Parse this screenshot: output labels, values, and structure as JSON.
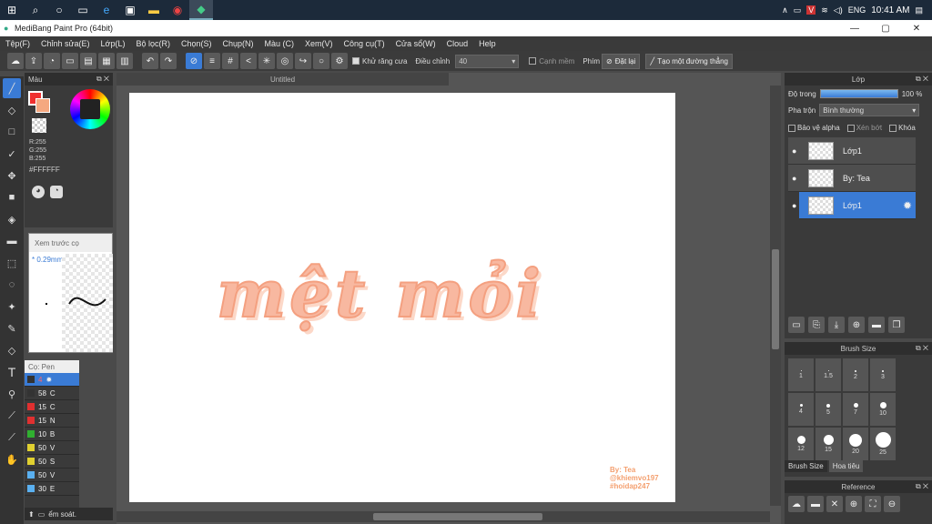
{
  "taskbar": {
    "tray": {
      "lang": "ENG",
      "time": "10:41 AM"
    }
  },
  "window": {
    "title": "MediBang Paint Pro (64bit)",
    "min": "—",
    "max": "▢",
    "close": "✕"
  },
  "menu": [
    "Tệp(F)",
    "Chỉnh sửa(E)",
    "Lớp(L)",
    "Bộ lọc(R)",
    "Chọn(S)",
    "Chụp(N)",
    "Màu (C)",
    "Xem(V)",
    "Công cụ(T)",
    "Cửa sổ(W)",
    "Cloud",
    "Help"
  ],
  "toolbar": {
    "antialias_label": "Khử răng cưa",
    "correction_label": "Điều chỉnh",
    "correction_value": "40",
    "soft_edge_label": "Cạnh mềm",
    "key_label": "Phím",
    "reset_label": "Đặt lại",
    "straight_line_label": "Tạo một đường thẳng"
  },
  "color_panel": {
    "title": "Màu",
    "r": "R:255",
    "g": "G:255",
    "b": "B:255",
    "hex": "#FFFFFF",
    "primary_color": "#f03030",
    "secondary_color": "#f5a880"
  },
  "preview": {
    "title": "Xem trước cọ",
    "size": "* 0.29mm"
  },
  "brush_panel": {
    "title": "Cọ: Pen",
    "items": [
      {
        "size": "4",
        "color": "#3a7bd5",
        "label": ""
      },
      {
        "size": "58",
        "color": "#333333",
        "label": "C"
      },
      {
        "size": "15",
        "color": "#e03030",
        "label": "C"
      },
      {
        "size": "15",
        "color": "#e03030",
        "label": "N"
      },
      {
        "size": "10",
        "color": "#30b030",
        "label": "B"
      },
      {
        "size": "50",
        "color": "#e0d030",
        "label": "V"
      },
      {
        "size": "50",
        "color": "#e0d030",
        "label": "S"
      },
      {
        "size": "50",
        "color": "#5ab0f0",
        "label": "V"
      },
      {
        "size": "30",
        "color": "#5ab0f0",
        "label": "E"
      }
    ],
    "footer": "ểm soát."
  },
  "canvas": {
    "tab": "Untitled",
    "art_text": "mệt mỏi",
    "signature": [
      "By: Tea",
      "@khiemvo197",
      "#hoidap247"
    ]
  },
  "layer_panel": {
    "title": "Lớp",
    "opacity_label": "Độ trong",
    "opacity_value": "100 %",
    "blend_label": "Pha trộn",
    "blend_value": "Bình thường",
    "protect_alpha": "Bảo vệ alpha",
    "clip": "Xén bớt",
    "lock": "Khóa",
    "layers": [
      {
        "name": "Lớp1"
      },
      {
        "name": "By: Tea"
      },
      {
        "name": "Lớp1"
      }
    ]
  },
  "brush_size_panel": {
    "title": "Brush Size",
    "sizes": [
      "1",
      "1.5",
      "2",
      "3",
      "4",
      "5",
      "7",
      "10",
      "12",
      "15",
      "20",
      "25"
    ],
    "tabs": [
      "Brush Size",
      "Hoa tiêu"
    ]
  },
  "reference_panel": {
    "title": "Reference"
  }
}
